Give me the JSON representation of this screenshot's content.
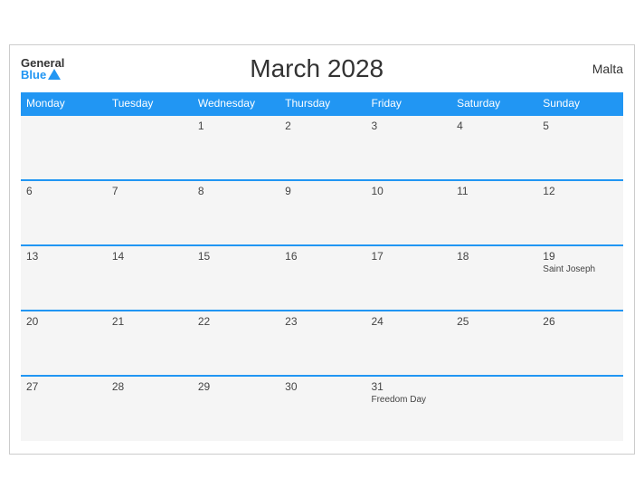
{
  "header": {
    "logo_general": "General",
    "logo_blue": "Blue",
    "title": "March 2028",
    "country": "Malta"
  },
  "weekdays": [
    "Monday",
    "Tuesday",
    "Wednesday",
    "Thursday",
    "Friday",
    "Saturday",
    "Sunday"
  ],
  "weeks": [
    [
      {
        "day": "",
        "event": ""
      },
      {
        "day": "",
        "event": ""
      },
      {
        "day": "1",
        "event": ""
      },
      {
        "day": "2",
        "event": ""
      },
      {
        "day": "3",
        "event": ""
      },
      {
        "day": "4",
        "event": ""
      },
      {
        "day": "5",
        "event": ""
      }
    ],
    [
      {
        "day": "6",
        "event": ""
      },
      {
        "day": "7",
        "event": ""
      },
      {
        "day": "8",
        "event": ""
      },
      {
        "day": "9",
        "event": ""
      },
      {
        "day": "10",
        "event": ""
      },
      {
        "day": "11",
        "event": ""
      },
      {
        "day": "12",
        "event": ""
      }
    ],
    [
      {
        "day": "13",
        "event": ""
      },
      {
        "day": "14",
        "event": ""
      },
      {
        "day": "15",
        "event": ""
      },
      {
        "day": "16",
        "event": ""
      },
      {
        "day": "17",
        "event": ""
      },
      {
        "day": "18",
        "event": ""
      },
      {
        "day": "19",
        "event": "Saint Joseph"
      }
    ],
    [
      {
        "day": "20",
        "event": ""
      },
      {
        "day": "21",
        "event": ""
      },
      {
        "day": "22",
        "event": ""
      },
      {
        "day": "23",
        "event": ""
      },
      {
        "day": "24",
        "event": ""
      },
      {
        "day": "25",
        "event": ""
      },
      {
        "day": "26",
        "event": ""
      }
    ],
    [
      {
        "day": "27",
        "event": ""
      },
      {
        "day": "28",
        "event": ""
      },
      {
        "day": "29",
        "event": ""
      },
      {
        "day": "30",
        "event": ""
      },
      {
        "day": "31",
        "event": "Freedom Day"
      },
      {
        "day": "",
        "event": ""
      },
      {
        "day": "",
        "event": ""
      }
    ]
  ]
}
